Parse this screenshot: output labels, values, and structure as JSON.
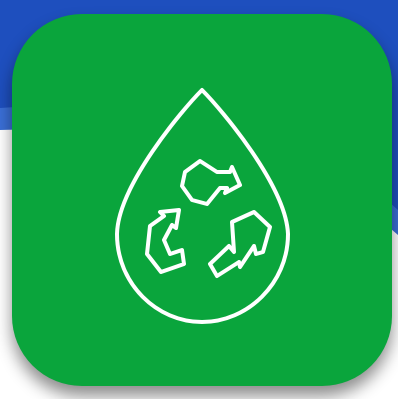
{
  "icon": {
    "name": "recycle-water-drop-icon",
    "background_color": "#0aa53c",
    "glyph_color": "#ffffff",
    "backdrop_color": "#1e4fbe"
  }
}
